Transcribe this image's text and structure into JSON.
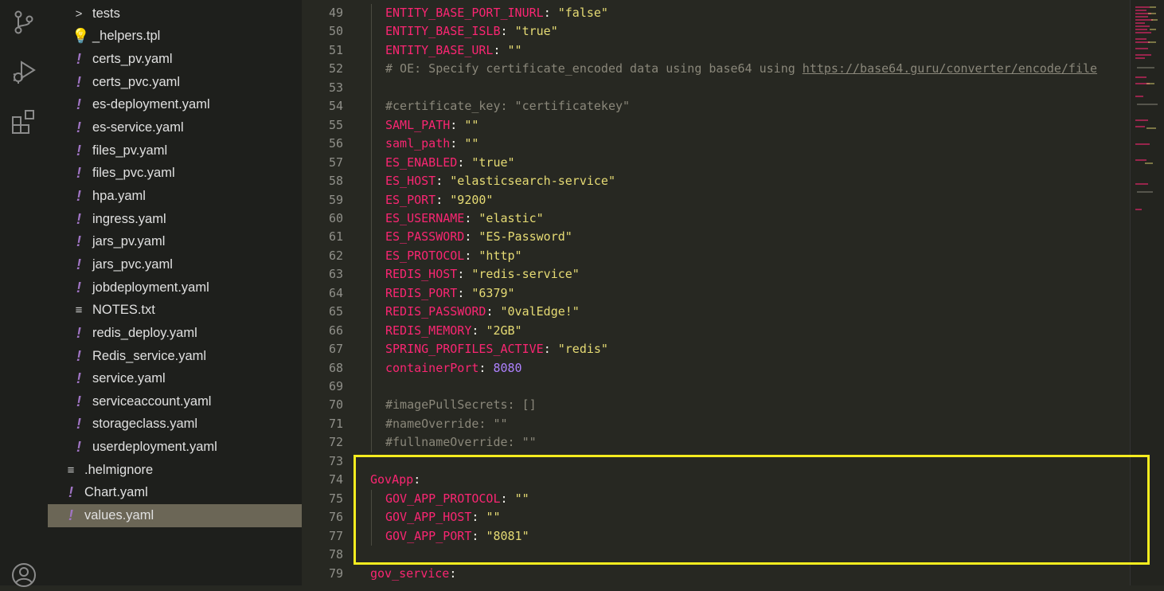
{
  "sidebar": {
    "files": [
      {
        "label": "tests",
        "icon": "chevron-right-icon",
        "glyph": ">",
        "indent": 1,
        "kind": "folder"
      },
      {
        "label": "_helpers.tpl",
        "icon": "lightbulb-icon",
        "glyph": "💡",
        "indent": 1,
        "kind": "tpl"
      },
      {
        "label": "certs_pv.yaml",
        "icon": "yaml-icon",
        "glyph": "!",
        "indent": 1,
        "kind": "yaml"
      },
      {
        "label": "certs_pvc.yaml",
        "icon": "yaml-icon",
        "glyph": "!",
        "indent": 1,
        "kind": "yaml"
      },
      {
        "label": "es-deployment.yaml",
        "icon": "yaml-icon",
        "glyph": "!",
        "indent": 1,
        "kind": "yaml"
      },
      {
        "label": "es-service.yaml",
        "icon": "yaml-icon",
        "glyph": "!",
        "indent": 1,
        "kind": "yaml"
      },
      {
        "label": "files_pv.yaml",
        "icon": "yaml-icon",
        "glyph": "!",
        "indent": 1,
        "kind": "yaml"
      },
      {
        "label": "files_pvc.yaml",
        "icon": "yaml-icon",
        "glyph": "!",
        "indent": 1,
        "kind": "yaml"
      },
      {
        "label": "hpa.yaml",
        "icon": "yaml-icon",
        "glyph": "!",
        "indent": 1,
        "kind": "yaml"
      },
      {
        "label": "ingress.yaml",
        "icon": "yaml-icon",
        "glyph": "!",
        "indent": 1,
        "kind": "yaml"
      },
      {
        "label": "jars_pv.yaml",
        "icon": "yaml-icon",
        "glyph": "!",
        "indent": 1,
        "kind": "yaml"
      },
      {
        "label": "jars_pvc.yaml",
        "icon": "yaml-icon",
        "glyph": "!",
        "indent": 1,
        "kind": "yaml"
      },
      {
        "label": "jobdeployment.yaml",
        "icon": "yaml-icon",
        "glyph": "!",
        "indent": 1,
        "kind": "yaml"
      },
      {
        "label": "NOTES.txt",
        "icon": "text-lines-icon",
        "glyph": "≡",
        "indent": 1,
        "kind": "txt"
      },
      {
        "label": "redis_deploy.yaml",
        "icon": "yaml-icon",
        "glyph": "!",
        "indent": 1,
        "kind": "yaml"
      },
      {
        "label": "Redis_service.yaml",
        "icon": "yaml-icon",
        "glyph": "!",
        "indent": 1,
        "kind": "yaml"
      },
      {
        "label": "service.yaml",
        "icon": "yaml-icon",
        "glyph": "!",
        "indent": 1,
        "kind": "yaml"
      },
      {
        "label": "serviceaccount.yaml",
        "icon": "yaml-icon",
        "glyph": "!",
        "indent": 1,
        "kind": "yaml"
      },
      {
        "label": "storageclass.yaml",
        "icon": "yaml-icon",
        "glyph": "!",
        "indent": 1,
        "kind": "yaml"
      },
      {
        "label": "userdeployment.yaml",
        "icon": "yaml-icon",
        "glyph": "!",
        "indent": 1,
        "kind": "yaml"
      },
      {
        "label": ".helmignore",
        "icon": "text-lines-icon",
        "glyph": "≡",
        "indent": 0,
        "kind": "txt"
      },
      {
        "label": "Chart.yaml",
        "icon": "yaml-icon",
        "glyph": "!",
        "indent": 0,
        "kind": "yaml"
      },
      {
        "label": "values.yaml",
        "icon": "yaml-icon",
        "glyph": "!",
        "indent": 0,
        "kind": "yaml",
        "active": true
      }
    ]
  },
  "editor": {
    "lines": [
      {
        "n": "49",
        "indent": 1,
        "tokens": [
          [
            "k",
            "ENTITY_BASE_PORT_INURL"
          ],
          [
            "p",
            ": "
          ],
          [
            "s",
            "\"false\""
          ]
        ]
      },
      {
        "n": "50",
        "indent": 1,
        "tokens": [
          [
            "k",
            "ENTITY_BASE_ISLB"
          ],
          [
            "p",
            ": "
          ],
          [
            "s",
            "\"true\""
          ]
        ]
      },
      {
        "n": "51",
        "indent": 1,
        "tokens": [
          [
            "k",
            "ENTITY_BASE_URL"
          ],
          [
            "p",
            ": "
          ],
          [
            "s",
            "\"\""
          ]
        ]
      },
      {
        "n": "52",
        "indent": 1,
        "tokens": [
          [
            "c",
            "# OE: Specify certificate_encoded data using base64 using "
          ],
          [
            "u",
            "https://base64.guru/converter/encode/file"
          ]
        ]
      },
      {
        "n": "53",
        "indent": 1,
        "tokens": []
      },
      {
        "n": "54",
        "indent": 1,
        "tokens": [
          [
            "c",
            "#certificate_key: \"certificatekey\""
          ]
        ]
      },
      {
        "n": "55",
        "indent": 1,
        "tokens": [
          [
            "k",
            "SAML_PATH"
          ],
          [
            "p",
            ": "
          ],
          [
            "s",
            "\"\""
          ]
        ]
      },
      {
        "n": "56",
        "indent": 1,
        "tokens": [
          [
            "k",
            "saml_path"
          ],
          [
            "p",
            ": "
          ],
          [
            "s",
            "\"\""
          ]
        ]
      },
      {
        "n": "57",
        "indent": 1,
        "tokens": [
          [
            "k",
            "ES_ENABLED"
          ],
          [
            "p",
            ": "
          ],
          [
            "s",
            "\"true\""
          ]
        ]
      },
      {
        "n": "58",
        "indent": 1,
        "tokens": [
          [
            "k",
            "ES_HOST"
          ],
          [
            "p",
            ": "
          ],
          [
            "s",
            "\"elasticsearch-service\""
          ]
        ]
      },
      {
        "n": "59",
        "indent": 1,
        "tokens": [
          [
            "k",
            "ES_PORT"
          ],
          [
            "p",
            ": "
          ],
          [
            "s",
            "\"9200\""
          ]
        ]
      },
      {
        "n": "60",
        "indent": 1,
        "tokens": [
          [
            "k",
            "ES_USERNAME"
          ],
          [
            "p",
            ": "
          ],
          [
            "s",
            "\"elastic\""
          ]
        ]
      },
      {
        "n": "61",
        "indent": 1,
        "tokens": [
          [
            "k",
            "ES_PASSWORD"
          ],
          [
            "p",
            ": "
          ],
          [
            "s",
            "\"ES-Password\""
          ]
        ]
      },
      {
        "n": "62",
        "indent": 1,
        "tokens": [
          [
            "k",
            "ES_PROTOCOL"
          ],
          [
            "p",
            ": "
          ],
          [
            "s",
            "\"http\""
          ]
        ]
      },
      {
        "n": "63",
        "indent": 1,
        "tokens": [
          [
            "k",
            "REDIS_HOST"
          ],
          [
            "p",
            ": "
          ],
          [
            "s",
            "\"redis-service\""
          ]
        ]
      },
      {
        "n": "64",
        "indent": 1,
        "tokens": [
          [
            "k",
            "REDIS_PORT"
          ],
          [
            "p",
            ": "
          ],
          [
            "s",
            "\"6379\""
          ]
        ]
      },
      {
        "n": "65",
        "indent": 1,
        "tokens": [
          [
            "k",
            "REDIS_PASSWORD"
          ],
          [
            "p",
            ": "
          ],
          [
            "s",
            "\"0valEdge!\""
          ]
        ]
      },
      {
        "n": "66",
        "indent": 1,
        "tokens": [
          [
            "k",
            "REDIS_MEMORY"
          ],
          [
            "p",
            ": "
          ],
          [
            "s",
            "\"2GB\""
          ]
        ]
      },
      {
        "n": "67",
        "indent": 1,
        "tokens": [
          [
            "k",
            "SPRING_PROFILES_ACTIVE"
          ],
          [
            "p",
            ": "
          ],
          [
            "s",
            "\"redis\""
          ]
        ]
      },
      {
        "n": "68",
        "indent": 1,
        "tokens": [
          [
            "k",
            "containerPort"
          ],
          [
            "p",
            ": "
          ],
          [
            "n",
            "8080"
          ]
        ]
      },
      {
        "n": "69",
        "indent": 1,
        "tokens": []
      },
      {
        "n": "70",
        "indent": 1,
        "tokens": [
          [
            "c",
            "#imagePullSecrets: []"
          ]
        ]
      },
      {
        "n": "71",
        "indent": 1,
        "tokens": [
          [
            "c",
            "#nameOverride: \"\""
          ]
        ]
      },
      {
        "n": "72",
        "indent": 1,
        "tokens": [
          [
            "c",
            "#fullnameOverride: \"\""
          ]
        ]
      },
      {
        "n": "73",
        "indent": 0,
        "tokens": []
      },
      {
        "n": "74",
        "indent": 0,
        "tokens": [
          [
            "k",
            "GovApp"
          ],
          [
            "p",
            ":"
          ]
        ]
      },
      {
        "n": "75",
        "indent": 1,
        "tokens": [
          [
            "k",
            "GOV_APP_PROTOCOL"
          ],
          [
            "p",
            ": "
          ],
          [
            "s",
            "\"\""
          ]
        ]
      },
      {
        "n": "76",
        "indent": 1,
        "tokens": [
          [
            "k",
            "GOV_APP_HOST"
          ],
          [
            "p",
            ": "
          ],
          [
            "s",
            "\"\""
          ]
        ]
      },
      {
        "n": "77",
        "indent": 1,
        "tokens": [
          [
            "k",
            "GOV_APP_PORT"
          ],
          [
            "p",
            ": "
          ],
          [
            "s",
            "\"8081\""
          ]
        ]
      },
      {
        "n": "78",
        "indent": 0,
        "tokens": []
      },
      {
        "n": "79",
        "indent": 0,
        "tokens": [
          [
            "k",
            "gov_service"
          ],
          [
            "p",
            ":"
          ]
        ]
      }
    ]
  },
  "activity_bar": {
    "icons": [
      "source-control-icon",
      "run-debug-icon",
      "extensions-icon",
      "account-icon"
    ]
  },
  "colors": {
    "highlight_box": "#f5ec1f",
    "key": "#f92672",
    "string": "#e6db74",
    "number": "#ae81ff",
    "comment": "#8a877a"
  }
}
